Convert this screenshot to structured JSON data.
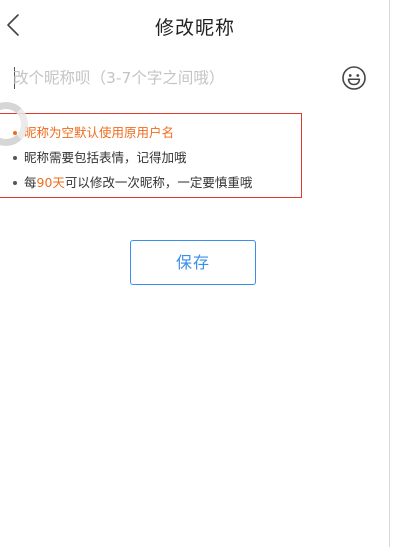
{
  "nav": {
    "title": "修改昵称",
    "back_icon": "chevron-left-icon"
  },
  "input": {
    "value": "",
    "placeholder": "改个昵称呗（3-7个字之间哦）",
    "emoji_icon": "smiley-icon"
  },
  "tips": {
    "items": [
      {
        "text": "昵称为空默认使用原用户名"
      },
      {
        "text": "昵称需要包括表情，记得加哦"
      },
      {
        "before": "每",
        "highlight": "90天",
        "after": "可以修改一次昵称，一定要慎重哦"
      }
    ]
  },
  "actions": {
    "save_label": "保存"
  },
  "colors": {
    "accent": "#3b8fe8",
    "warning": "#ef6c1e",
    "border_red": "#e0382f"
  }
}
